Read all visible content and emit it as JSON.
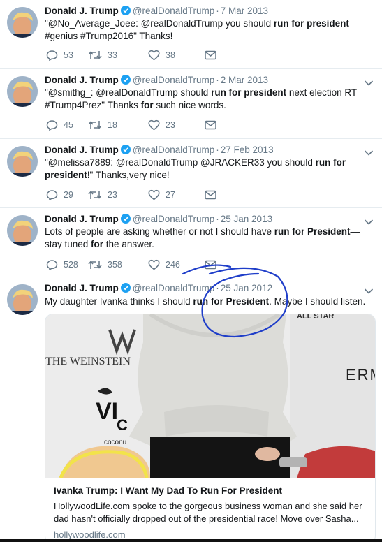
{
  "colors": {
    "annotation": "#1f3ec9",
    "icon_gray": "#657786",
    "verified": "#1da1f2",
    "divider": "#e6ecf0"
  },
  "tweets": [
    {
      "name": "Donald J. Trump",
      "handle": "@realDonaldTrump",
      "separator": "·",
      "date": "7 Mar 2013",
      "text_parts": [
        {
          "t": "\"@No_Average_Joee: @realDonaldTrump you should ",
          "b": false
        },
        {
          "t": "run for president",
          "b": true
        },
        {
          "t": " #genius #Trump2016\"  Thanks!",
          "b": false
        }
      ],
      "replies": "53",
      "retweets": "33",
      "likes": "38"
    },
    {
      "name": "Donald J. Trump",
      "handle": "@realDonaldTrump",
      "separator": "·",
      "date": "2 Mar 2013",
      "text_parts": [
        {
          "t": "\"@smithg_: @realDonaldTrump should ",
          "b": false
        },
        {
          "t": "run for president",
          "b": true
        },
        {
          "t": " next election RT #Trump4Prez\"   Thanks ",
          "b": false
        },
        {
          "t": "for",
          "b": true
        },
        {
          "t": " such nice words.",
          "b": false
        }
      ],
      "replies": "45",
      "retweets": "18",
      "likes": "23"
    },
    {
      "name": "Donald J. Trump",
      "handle": "@realDonaldTrump",
      "separator": "·",
      "date": "27 Feb 2013",
      "text_parts": [
        {
          "t": "\"@melissa7889: @realDonaldTrump @JRACKER33 you should ",
          "b": false
        },
        {
          "t": "run for president",
          "b": true
        },
        {
          "t": "!\" Thanks,very nice!",
          "b": false
        }
      ],
      "replies": "29",
      "retweets": "23",
      "likes": "27"
    },
    {
      "name": "Donald J. Trump",
      "handle": "@realDonaldTrump",
      "separator": "·",
      "date": "25 Jan 2013",
      "text_parts": [
        {
          "t": "Lots of people are asking whether or not I should have ",
          "b": false
        },
        {
          "t": "run for President",
          "b": true
        },
        {
          "t": "—stay tuned ",
          "b": false
        },
        {
          "t": "for",
          "b": true
        },
        {
          "t": " the answer.",
          "b": false
        }
      ],
      "replies": "528",
      "retweets": "358",
      "likes": "246"
    },
    {
      "name": "Donald J. Trump",
      "handle": "@realDonaldTrump",
      "separator": "·",
      "date": "25 Jan 2012",
      "text_parts": [
        {
          "t": "My daughter Ivanka thinks I should ",
          "b": false
        },
        {
          "t": "run for President",
          "b": true
        },
        {
          "t": ". Maybe I should listen.",
          "b": false
        }
      ]
    }
  ],
  "card": {
    "title": "Ivanka Trump: I Want My Dad To Run For President",
    "description": "HollywoodLife.com spoke to the gorgeous business woman and she said her dad hasn't officially dropped out of the presidential race! Move over Sasha...",
    "domain": "hollywoodlife.com",
    "backdrop_text_1": "THE WEINSTEIN",
    "backdrop_text_2": "ERM",
    "backdrop_text_3": "coconu",
    "backdrop_text_4": "ALL STAR",
    "backdrop_text_5": "VI",
    "backdrop_text_6": "C"
  }
}
